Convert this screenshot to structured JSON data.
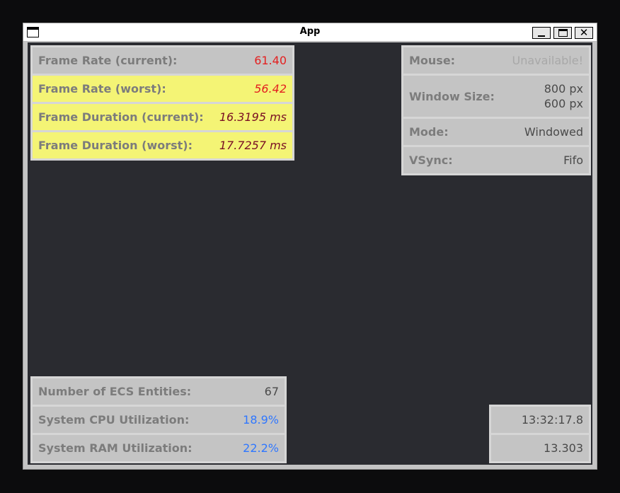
{
  "window": {
    "title": "App"
  },
  "frame_panel": {
    "rows": [
      {
        "label": "Frame Rate (current):",
        "value": "61.40"
      },
      {
        "label": "Frame Rate (worst):",
        "value": "56.42"
      },
      {
        "label": "Frame Duration (current):",
        "value": "16.3195 ms"
      },
      {
        "label": "Frame Duration (worst):",
        "value": "17.7257 ms"
      }
    ]
  },
  "info_panel": {
    "mouse": {
      "label": "Mouse:",
      "value": "Unavailable!"
    },
    "window_size": {
      "label": "Window Size:",
      "width": "800 px",
      "height": "600 px"
    },
    "mode": {
      "label": "Mode:",
      "value": "Windowed"
    },
    "vsync": {
      "label": "VSync:",
      "value": "Fifo"
    }
  },
  "system_panel": {
    "rows": [
      {
        "label": "Number of ECS Entities:",
        "value": "67"
      },
      {
        "label": "System CPU Utilization:",
        "value": "18.9%"
      },
      {
        "label": "System RAM Utilization:",
        "value": "22.2%"
      }
    ]
  },
  "time_panel": {
    "clock": "13:32:17.8",
    "elapsed": "13.303"
  },
  "colors": {
    "canvas": "#2a2b30",
    "row_bg": "#c4c4c4",
    "highlight": "#f4f475",
    "red": "#e32020",
    "blue": "#2f77ff"
  },
  "icons": {
    "system_menu": "window-icon",
    "minimize": "minimize-icon",
    "maximize": "maximize-icon",
    "close": "close-icon"
  }
}
